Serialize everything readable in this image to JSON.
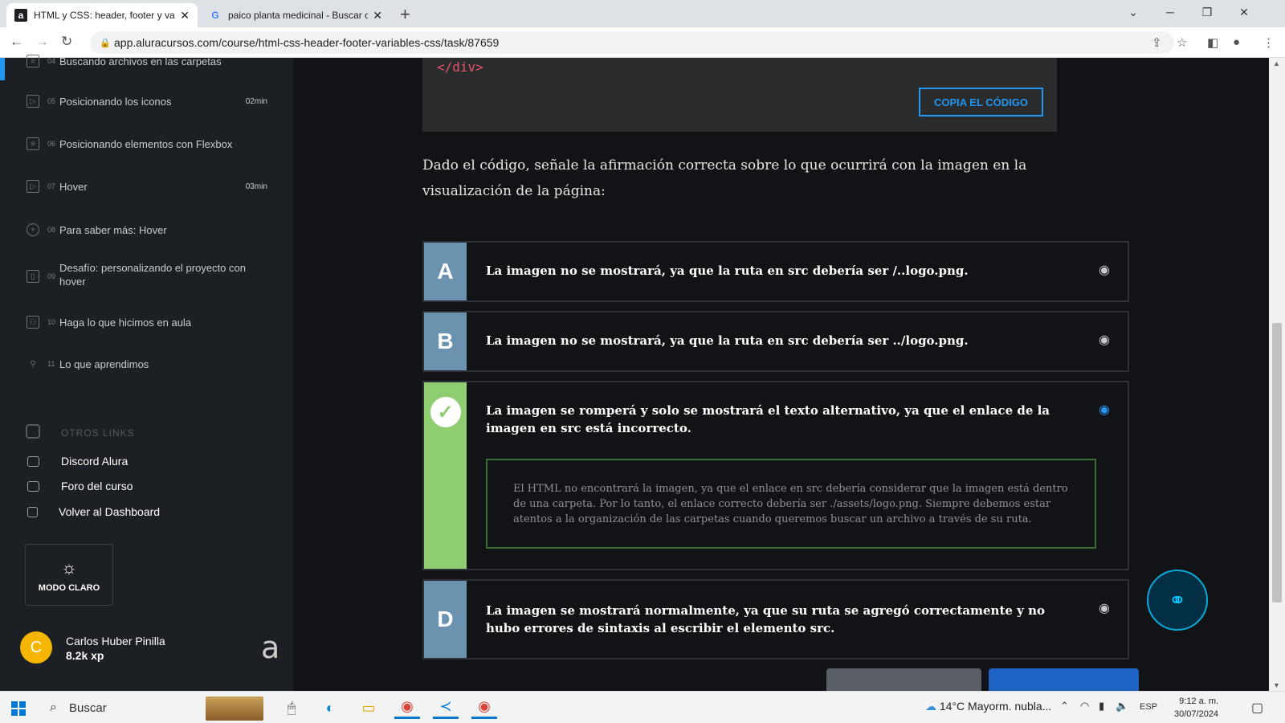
{
  "browser": {
    "tabs": [
      {
        "title": "HTML y CSS: header, footer y var",
        "favicon": "a"
      },
      {
        "title": "paico planta medicinal - Buscar c",
        "favicon": "G"
      }
    ],
    "url": "app.aluracursos.com/course/html-css-header-footer-variables-css/task/87659"
  },
  "sidebar": {
    "lessons": [
      {
        "num": "04",
        "label": "Buscando archivos en las carpetas",
        "duration": ""
      },
      {
        "num": "05",
        "label": "Posicionando los iconos",
        "duration": "02min"
      },
      {
        "num": "06",
        "label": "Posicionando elementos con Flexbox",
        "duration": ""
      },
      {
        "num": "07",
        "label": "Hover",
        "duration": "03min"
      },
      {
        "num": "08",
        "label": "Para saber más: Hover",
        "duration": ""
      },
      {
        "num": "09",
        "label": "Desafío: personalizando el proyecto con hover",
        "duration": ""
      },
      {
        "num": "10",
        "label": "Haga lo que hicimos en aula",
        "duration": ""
      },
      {
        "num": "11",
        "label": "Lo que aprendimos",
        "duration": ""
      }
    ],
    "otros_links_title": "OTROS LINKS",
    "links": [
      "Discord Alura",
      "Foro del curso",
      "Volver al Dashboard"
    ],
    "mode_button": "MODO CLARO",
    "user": {
      "initial": "C",
      "name": "Carlos Huber Pinilla",
      "xp": "8.2k xp"
    }
  },
  "main": {
    "code_snippet": "</div>",
    "copy_button": "COPIA EL CÓDIGO",
    "question": "Dado el código, señale la afirmación correcta sobre lo que ocurrirá con la imagen en la visualización de la página:",
    "options": [
      {
        "letter": "A",
        "text": "La imagen no se mostrará, ya que la ruta en src debería ser /..logo.png."
      },
      {
        "letter": "B",
        "text": "La imagen no se mostrará, ya que la ruta en src debería ser ../logo.png."
      },
      {
        "letter": "C",
        "text": "La imagen se romperá y solo se mostrará el texto alternativo, ya que el enlace de la imagen en src está incorrecto.",
        "explanation": "El HTML no encontrará la imagen, ya que el enlace en src debería considerar que la imagen está dentro de una carpeta. Por lo tanto, el enlace correcto debería ser ./assets/logo.png. Siempre debemos estar atentos a la organización de las carpetas cuando queremos buscar un archivo a través de su ruta."
      },
      {
        "letter": "D",
        "text": "La imagen se mostrará normalmente, ya que su ruta se agregó correctamente y no hubo errores de sintaxis al escribir el elemento src."
      }
    ]
  },
  "taskbar": {
    "search_placeholder": "Buscar",
    "weather": "14°C  Mayorm. nubla...",
    "language": "ESP",
    "time": "9:12 a. m.",
    "date": "30/07/2024"
  },
  "colors": {
    "accent_blue": "#2196f3",
    "correct_green": "#8fce70",
    "letter_blue": "#6b93b0"
  }
}
